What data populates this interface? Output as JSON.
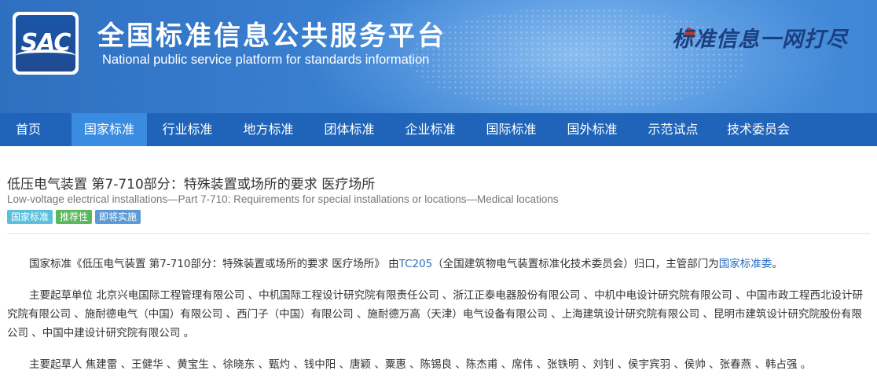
{
  "header": {
    "logo_text": "SAC",
    "title": "全国标准信息公共服务平台",
    "subtitle": "National public service platform  for standards information",
    "slogan": "标准信息一网打尽"
  },
  "nav": {
    "items": [
      {
        "label": "首页",
        "active": false
      },
      {
        "label": "国家标准",
        "active": true
      },
      {
        "label": "行业标准",
        "active": false
      },
      {
        "label": "地方标准",
        "active": false
      },
      {
        "label": "团体标准",
        "active": false
      },
      {
        "label": "企业标准",
        "active": false
      },
      {
        "label": "国际标准",
        "active": false
      },
      {
        "label": "国外标准",
        "active": false
      },
      {
        "label": "示范试点",
        "active": false
      },
      {
        "label": "技术委员会",
        "active": false
      }
    ]
  },
  "standard": {
    "title": "低压电气装置 第7-710部分：特殊装置或场所的要求 医疗场所",
    "title_en": "Low-voltage electrical installations—Part 7-710: Requirements for special installations or locations—Medical locations",
    "tags": [
      "国家标准",
      "推荐性",
      "即将实施"
    ],
    "intro_prefix": "国家标准《低压电气装置 第7-710部分：特殊装置或场所的要求 医疗场所》 由",
    "tc_link": "TC205",
    "intro_middle": "（全国建筑物电气装置标准化技术委员会）归口，主管部门为",
    "dept_link": "国家标准委",
    "intro_suffix": "。",
    "drafting_units": "主要起草单位 北京兴电国际工程管理有限公司 、中机国际工程设计研究院有限责任公司 、浙江正泰电器股份有限公司 、中机中电设计研究院有限公司 、中国市政工程西北设计研究院有限公司 、施耐德电气（中国）有限公司 、西门子（中国）有限公司 、施耐德万高（天津）电气设备有限公司 、上海建筑设计研究院有限公司 、昆明市建筑设计研究院股份有限公司 、中国中建设计研究院有限公司 。",
    "drafters": "主要起草人 焦建雷 、王健华 、黄宝生 、徐晓东 、甄灼 、钱中阳 、唐颖 、粟惠 、陈锡良 、陈杰甫 、席伟 、张铁明 、刘钊 、侯宇宾羽 、侯帅 、张春燕 、韩占强 。"
  },
  "colors": {
    "nav_bg": "#1f64b8",
    "nav_active": "#3a8ce0",
    "link": "#2a6ebd"
  }
}
